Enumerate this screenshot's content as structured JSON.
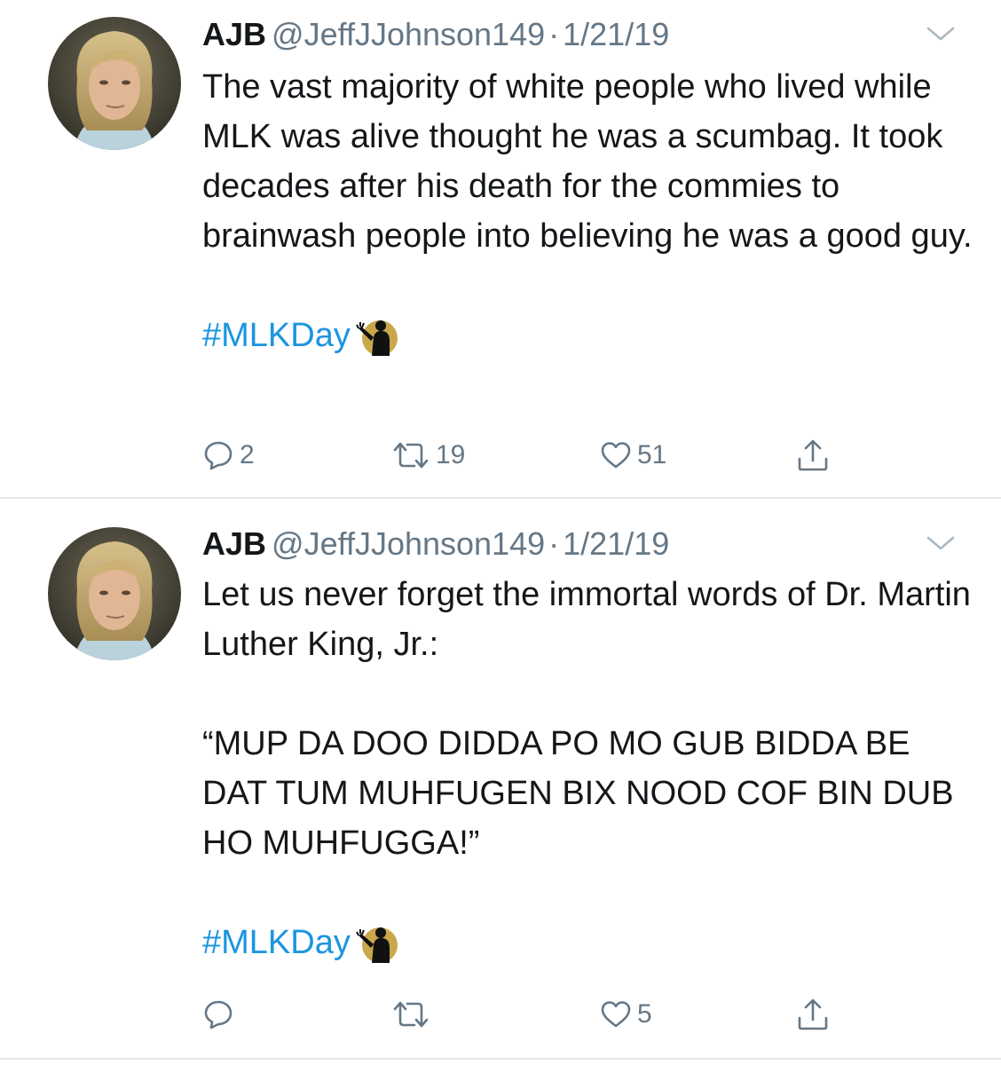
{
  "tweets": [
    {
      "author_name": "AJB",
      "handle": "@JeffJJohnson149",
      "separator": "·",
      "date": "1/21/19",
      "text": "The vast majority of white people who lived while MLK was alive thought he was a scumbag. It took decades after his death for the commies to brainwash people into believing he was a good guy.",
      "hashtag": "#MLKDay",
      "hashtag_emoji": "person-speaking-silhouette",
      "reply_count": "2",
      "retweet_count": "19",
      "like_count": "51"
    },
    {
      "author_name": "AJB",
      "handle": "@JeffJJohnson149",
      "separator": "·",
      "date": "1/21/19",
      "text_intro": "Let us never forget the immortal words of Dr. Martin Luther King, Jr.:",
      "text_quote": "“MUP DA DOO DIDDA PO MO GUB BIDDA BE DAT TUM MUHFUGEN BIX NOOD COF BIN DUB HO MUHFUGGA!”",
      "hashtag": "#MLKDay",
      "hashtag_emoji": "person-speaking-silhouette",
      "reply_count": "",
      "retweet_count": "",
      "like_count": "5"
    }
  ],
  "icons": {
    "caret": "chevron-down-icon",
    "reply": "speech-bubble-icon",
    "retweet": "retweet-arrows-icon",
    "like": "heart-outline-icon",
    "share": "share-upload-icon"
  },
  "colors": {
    "text": "#14171a",
    "muted": "#657786",
    "link": "#1b95e0",
    "divider": "#e1e8ed"
  }
}
